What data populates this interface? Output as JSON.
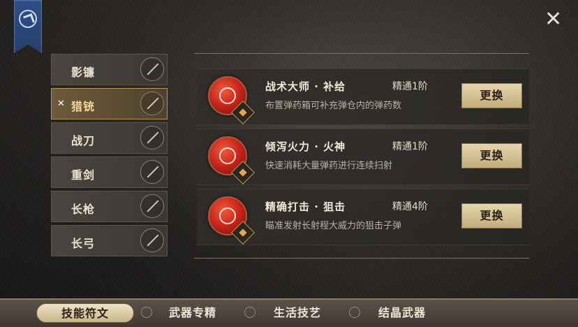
{
  "close_label": "✕",
  "weapons": [
    {
      "label": "影镰",
      "icon": "scythe-icon"
    },
    {
      "label": "猎铳",
      "icon": "musket-icon",
      "selected": true
    },
    {
      "label": "战刀",
      "icon": "saber-icon"
    },
    {
      "label": "重剑",
      "icon": "greatsword-icon"
    },
    {
      "label": "长枪",
      "icon": "spear-icon"
    },
    {
      "label": "长弓",
      "icon": "longbow-icon"
    }
  ],
  "skills": [
    {
      "name": "战术大师 · 补给",
      "level": "精通1阶",
      "desc": "布置弹药箱可补充弹仓内的弹药数",
      "button": "更换"
    },
    {
      "name": "倾泻火力 · 火神",
      "level": "精通1阶",
      "desc": "快速消耗大量弹药进行连续扫射",
      "button": "更换"
    },
    {
      "name": "精确打击 · 狙击",
      "level": "精通4阶",
      "desc": "瞄准发射长射程大威力的狙击子弹",
      "button": "更换"
    }
  ],
  "tabs": [
    {
      "label": "技能符文",
      "active": true
    },
    {
      "label": "武器专精"
    },
    {
      "label": "生活技艺"
    },
    {
      "label": "结晶武器"
    }
  ],
  "colors": {
    "accent": "#c4ad7c",
    "selected_border": "#b79454",
    "skill_red": "#c8231a"
  }
}
